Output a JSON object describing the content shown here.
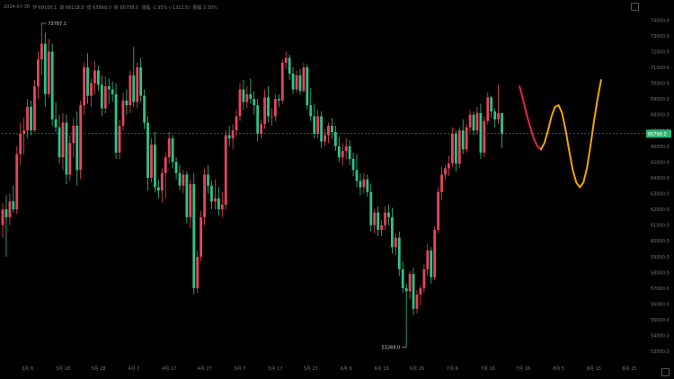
{
  "header": {
    "date": "2024-07-30",
    "open": "开 68100.1",
    "high": "高 68118.5",
    "low": "低 65868.0",
    "close": "收 66798.0",
    "change": "涨幅 -1.95% (-1312.5)",
    "amplitude": "振幅 3.30%"
  },
  "colors": {
    "up": "#e8445a",
    "down": "#2bc48a",
    "forecast_a": "#e8214f",
    "forecast_b": "#f0a500",
    "price_tag": "#2bb673"
  },
  "chart_data": {
    "type": "candlestick",
    "ylim": [
      52500,
      74700
    ],
    "y_ticks": [
      53000,
      54000,
      55000,
      56000,
      57000,
      58000,
      59000,
      60000,
      61000,
      62000,
      63000,
      64000,
      65000,
      66000,
      67000,
      68000,
      69000,
      70000,
      71000,
      72000,
      73000,
      74000
    ],
    "y_tick_labels": [
      "53000.0",
      "54000.0",
      "55000.0",
      "56000.0",
      "57000.0",
      "58000.0",
      "59000.0",
      "60000.0",
      "61000.0",
      "62000.0",
      "63000.0",
      "64000.0",
      "65000.0",
      "66000.0",
      "67000.0",
      "68000.0",
      "69000.0",
      "70000.0",
      "71000.0",
      "72000.0",
      "73000.0",
      "74000.0"
    ],
    "x_tick_labels": [
      {
        "label": "3月 8",
        "index": 7
      },
      {
        "label": "3月 18",
        "index": 17
      },
      {
        "label": "3月 28",
        "index": 27
      },
      {
        "label": "4月 7",
        "index": 37
      },
      {
        "label": "4月 17",
        "index": 47
      },
      {
        "label": "4月 27",
        "index": 57
      },
      {
        "label": "5月 7",
        "index": 67
      },
      {
        "label": "5月 17",
        "index": 77
      },
      {
        "label": "5月 27",
        "index": 87
      },
      {
        "label": "6月 6",
        "index": 97
      },
      {
        "label": "6月 16",
        "index": 107
      },
      {
        "label": "6月 26",
        "index": 117
      },
      {
        "label": "7月 6",
        "index": 127
      },
      {
        "label": "7月 16",
        "index": 137
      },
      {
        "label": "7月 26",
        "index": 147
      },
      {
        "label": "8月 5",
        "index": 157
      },
      {
        "label": "8月 15",
        "index": 167
      },
      {
        "label": "8月 25",
        "index": 177
      }
    ],
    "candles": [
      [
        61000,
        62400,
        60200,
        62000
      ],
      [
        62000,
        62900,
        59000,
        61500
      ],
      [
        61500,
        63000,
        61000,
        62500
      ],
      [
        62500,
        63500,
        61800,
        62000
      ],
      [
        62000,
        66000,
        61700,
        65500
      ],
      [
        65500,
        67500,
        64800,
        66800
      ],
      [
        66800,
        67800,
        65500,
        67000
      ],
      [
        67000,
        69000,
        66500,
        68500
      ],
      [
        68500,
        68900,
        66700,
        67000
      ],
      [
        67000,
        70200,
        66900,
        69800
      ],
      [
        69800,
        72000,
        69000,
        71500
      ],
      [
        71500,
        73787,
        70500,
        72500
      ],
      [
        72500,
        73200,
        68500,
        69300
      ],
      [
        69300,
        72800,
        69100,
        72000
      ],
      [
        72000,
        72500,
        67300,
        67700
      ],
      [
        67700,
        68800,
        66900,
        67200
      ],
      [
        67200,
        68000,
        64900,
        65300
      ],
      [
        65300,
        68100,
        64500,
        67500
      ],
      [
        67500,
        68000,
        63600,
        64200
      ],
      [
        64200,
        66700,
        63800,
        66200
      ],
      [
        66200,
        67800,
        65300,
        67300
      ],
      [
        67300,
        68200,
        63500,
        64500
      ],
      [
        64500,
        68900,
        63900,
        68600
      ],
      [
        68600,
        71300,
        68000,
        71000
      ],
      [
        71000,
        71900,
        68700,
        69200
      ],
      [
        69200,
        70300,
        68500,
        70000
      ],
      [
        70000,
        71400,
        69300,
        70800
      ],
      [
        70800,
        71100,
        69500,
        69900
      ],
      [
        69900,
        70500,
        67900,
        68400
      ],
      [
        68400,
        70400,
        68100,
        69800
      ],
      [
        69800,
        70300,
        68700,
        69600
      ],
      [
        69600,
        70100,
        68800,
        69300
      ],
      [
        69300,
        70000,
        65200,
        65600
      ],
      [
        65600,
        67700,
        65200,
        67300
      ],
      [
        67300,
        69400,
        67000,
        68900
      ],
      [
        68900,
        69600,
        68000,
        68600
      ],
      [
        68600,
        70800,
        68100,
        70500
      ],
      [
        70500,
        72300,
        68500,
        68800
      ],
      [
        68800,
        71300,
        68400,
        71000
      ],
      [
        71000,
        71600,
        68800,
        69200
      ],
      [
        69200,
        69600,
        67100,
        67500
      ],
      [
        67500,
        67900,
        63200,
        64000
      ],
      [
        64000,
        66500,
        63700,
        66100
      ],
      [
        66100,
        66900,
        63100,
        63400
      ],
      [
        63400,
        63900,
        62700,
        63200
      ],
      [
        63200,
        64600,
        62400,
        64300
      ],
      [
        64300,
        65600,
        62700,
        65300
      ],
      [
        65300,
        66900,
        64900,
        66500
      ],
      [
        66500,
        66700,
        64600,
        65000
      ],
      [
        65000,
        65300,
        63900,
        64300
      ],
      [
        64300,
        64800,
        63200,
        63500
      ],
      [
        63500,
        64500,
        63000,
        64200
      ],
      [
        64200,
        64400,
        61100,
        61500
      ],
      [
        61500,
        63900,
        60800,
        63600
      ],
      [
        63600,
        64300,
        56600,
        57000
      ],
      [
        57000,
        59400,
        56700,
        59000
      ],
      [
        59000,
        61900,
        58700,
        61500
      ],
      [
        61500,
        64600,
        61000,
        64200
      ],
      [
        64200,
        64800,
        63000,
        63500
      ],
      [
        63500,
        63800,
        62000,
        62500
      ],
      [
        62500,
        63900,
        62000,
        62700
      ],
      [
        62700,
        63400,
        61600,
        62000
      ],
      [
        62000,
        63100,
        61500,
        62300
      ],
      [
        62300,
        67000,
        62000,
        66700
      ],
      [
        66700,
        67300,
        66000,
        66500
      ],
      [
        66500,
        67400,
        65800,
        67000
      ],
      [
        67000,
        68300,
        66600,
        67900
      ],
      [
        67900,
        70000,
        67600,
        69600
      ],
      [
        69600,
        70200,
        68300,
        68800
      ],
      [
        68800,
        69800,
        68400,
        69300
      ],
      [
        69300,
        70300,
        68700,
        69000
      ],
      [
        69000,
        69500,
        68000,
        68600
      ],
      [
        68600,
        69000,
        66300,
        66800
      ],
      [
        66800,
        67700,
        66500,
        67400
      ],
      [
        67400,
        69600,
        67100,
        69100
      ],
      [
        69100,
        69800,
        67500,
        67900
      ],
      [
        67900,
        68400,
        67300,
        67900
      ],
      [
        67900,
        69300,
        67600,
        69000
      ],
      [
        69000,
        69300,
        68500,
        68900
      ],
      [
        68900,
        71500,
        68700,
        71300
      ],
      [
        71300,
        72000,
        70900,
        71600
      ],
      [
        71600,
        71800,
        70200,
        70600
      ],
      [
        70600,
        71000,
        69300,
        69600
      ],
      [
        69600,
        70800,
        69400,
        70500
      ],
      [
        70500,
        70900,
        69300,
        69500
      ],
      [
        69500,
        71300,
        69400,
        71000
      ],
      [
        71000,
        71200,
        68300,
        68600
      ],
      [
        68600,
        69700,
        67600,
        67900
      ],
      [
        67900,
        68700,
        66500,
        66800
      ],
      [
        66800,
        68300,
        66500,
        67900
      ],
      [
        67900,
        68200,
        65900,
        66300
      ],
      [
        66300,
        67100,
        66000,
        66700
      ],
      [
        66700,
        67500,
        66200,
        67300
      ],
      [
        67300,
        67800,
        66500,
        66900
      ],
      [
        66900,
        67300,
        65700,
        66000
      ],
      [
        66000,
        66600,
        65000,
        65300
      ],
      [
        65300,
        66200,
        64800,
        65700
      ],
      [
        65700,
        66500,
        65200,
        66000
      ],
      [
        66000,
        66400,
        64800,
        65200
      ],
      [
        65200,
        65600,
        64100,
        64500
      ],
      [
        64500,
        65500,
        63400,
        63800
      ],
      [
        63800,
        64300,
        62900,
        63400
      ],
      [
        63400,
        64300,
        63000,
        63900
      ],
      [
        63900,
        64200,
        62800,
        63100
      ],
      [
        63100,
        63600,
        60600,
        61000
      ],
      [
        61000,
        62000,
        60500,
        61800
      ],
      [
        61800,
        62200,
        60300,
        60700
      ],
      [
        60700,
        61300,
        60300,
        61000
      ],
      [
        61000,
        62200,
        60700,
        61800
      ],
      [
        61800,
        62300,
        61000,
        61500
      ],
      [
        61500,
        62100,
        59200,
        59600
      ],
      [
        59600,
        60500,
        59100,
        60200
      ],
      [
        60200,
        60600,
        57800,
        58200
      ],
      [
        58200,
        58700,
        56700,
        57000
      ],
      [
        57000,
        57300,
        53269,
        56800
      ],
      [
        56800,
        58100,
        56300,
        57900
      ],
      [
        57900,
        58300,
        55300,
        55700
      ],
      [
        55700,
        56900,
        55400,
        56600
      ],
      [
        56600,
        57200,
        55900,
        57000
      ],
      [
        57000,
        58500,
        56700,
        58200
      ],
      [
        58200,
        59800,
        57800,
        59400
      ],
      [
        59400,
        59600,
        57300,
        57700
      ],
      [
        57700,
        60900,
        57500,
        60700
      ],
      [
        60700,
        63400,
        60500,
        63100
      ],
      [
        63100,
        64700,
        62600,
        64200
      ],
      [
        64200,
        64800,
        63900,
        64600
      ],
      [
        64600,
        65400,
        64100,
        64900
      ],
      [
        64900,
        67200,
        64700,
        66800
      ],
      [
        66800,
        67000,
        64400,
        64900
      ],
      [
        64900,
        67200,
        64600,
        67000
      ],
      [
        67000,
        67700,
        65500,
        65800
      ],
      [
        65800,
        67400,
        65600,
        67200
      ],
      [
        67200,
        68300,
        66900,
        68000
      ],
      [
        68000,
        68200,
        66700,
        67000
      ],
      [
        67000,
        68500,
        66800,
        68100
      ],
      [
        68100,
        68700,
        65200,
        65600
      ],
      [
        65600,
        67900,
        65300,
        67600
      ],
      [
        67600,
        69400,
        67400,
        69100
      ],
      [
        69100,
        69200,
        67800,
        68200
      ],
      [
        68200,
        68400,
        67200,
        67700
      ],
      [
        67700,
        69900,
        67400,
        68100
      ],
      [
        68100,
        68118,
        65868,
        66798
      ]
    ],
    "forecast_a": [
      [
        146,
        69800
      ],
      [
        147,
        68900
      ],
      [
        148,
        68000
      ],
      [
        149,
        67200
      ],
      [
        150,
        66500
      ],
      [
        151,
        66000
      ],
      [
        152,
        65800
      ]
    ],
    "forecast_b": [
      [
        152,
        65800
      ],
      [
        153,
        66200
      ],
      [
        154,
        67000
      ],
      [
        155,
        67900
      ],
      [
        156,
        68500
      ],
      [
        157,
        68600
      ],
      [
        158,
        68100
      ],
      [
        159,
        67000
      ],
      [
        160,
        65700
      ],
      [
        161,
        64500
      ],
      [
        162,
        63700
      ],
      [
        163,
        63400
      ],
      [
        164,
        63700
      ],
      [
        165,
        64600
      ],
      [
        166,
        66000
      ],
      [
        167,
        67600
      ],
      [
        168,
        69000
      ],
      [
        169,
        70200
      ]
    ],
    "last_price": 66798,
    "last_price_label": "66798.0",
    "annotations": [
      {
        "text": "73787.1",
        "index": 11,
        "value": 73787,
        "side": "right"
      },
      {
        "text": "53269.0",
        "index": 114,
        "value": 53269,
        "side": "left"
      }
    ]
  }
}
